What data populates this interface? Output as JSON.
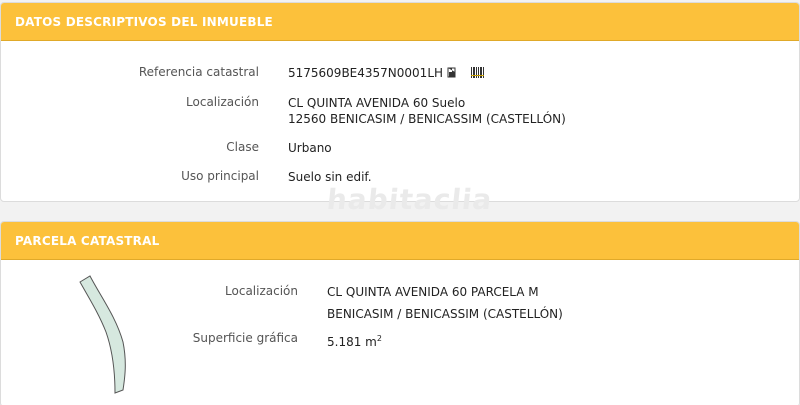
{
  "inmueble": {
    "title": "DATOS DESCRIPTIVOS DEL INMUEBLE",
    "rows": [
      {
        "label": "Referencia catastral",
        "value": "5175609BE4357N0001LH"
      },
      {
        "label": "Localización",
        "value_line1": "CL QUINTA AVENIDA 60 Suelo",
        "value_line2": "12560 BENICASIM / BENICASSIM (CASTELLÓN)"
      },
      {
        "label": "Clase",
        "value": "Urbano"
      },
      {
        "label": "Uso principal",
        "value": "Suelo sin edif."
      }
    ],
    "icons": [
      "document-icon",
      "barcode-icon"
    ]
  },
  "watermark": "habitaclia",
  "parcela": {
    "title": "PARCELA CATASTRAL",
    "rows": [
      {
        "label": "Localización",
        "value_line1": "CL QUINTA AVENIDA 60 PARCELA M",
        "value_line2": "BENICASIM / BENICASSIM (CASTELLÓN)"
      },
      {
        "label": "Superficie gráfica",
        "value": "5.181 m",
        "unit_sup": "2"
      }
    ]
  },
  "colors": {
    "header": "#fcc13b",
    "parcel_fill": "#d6e8df",
    "parcel_stroke": "#555555"
  }
}
